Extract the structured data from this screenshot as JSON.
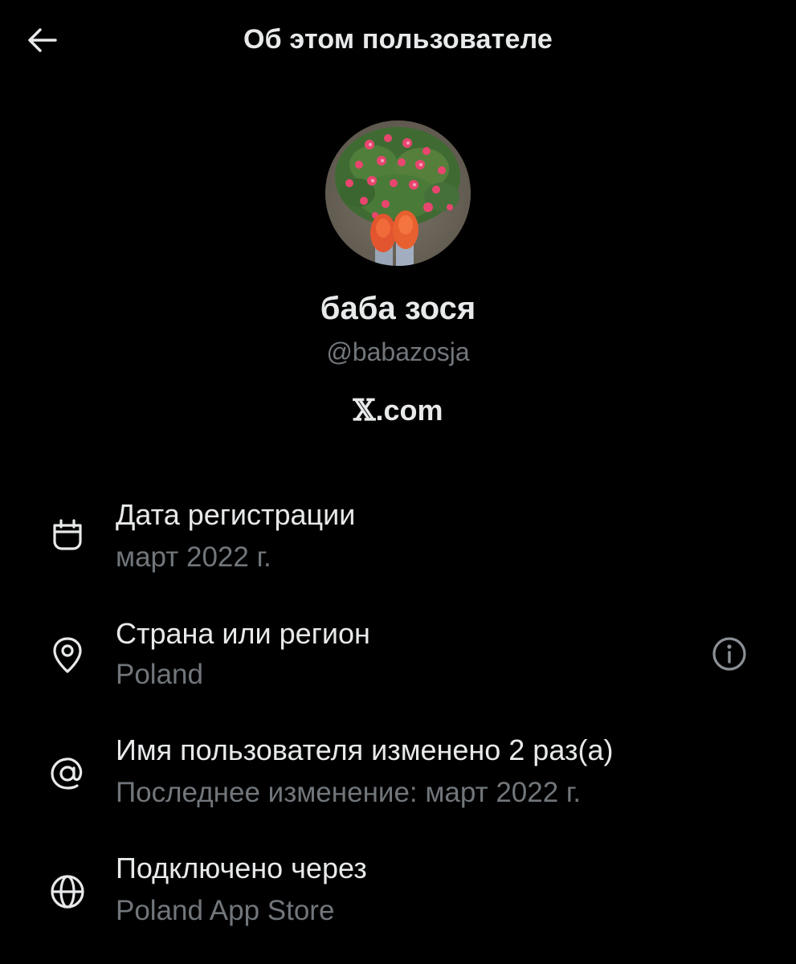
{
  "header": {
    "title": "Об этом пользователе",
    "back_icon": "arrow-left-icon"
  },
  "profile": {
    "display_name": "баба зося",
    "handle": "@babazosja",
    "platform_glyph": "𝕏",
    "platform_suffix": ".com",
    "avatar": "flowers-and-orange-shoes-photo"
  },
  "info": {
    "joined": {
      "icon": "calendar-icon",
      "title": "Дата регистрации",
      "value": "март 2022 г."
    },
    "country": {
      "icon": "location-pin-icon",
      "title": "Страна или регион",
      "value": "Poland",
      "help_icon": "info-circle-icon"
    },
    "username_changes": {
      "icon": "at-sign-icon",
      "title": "Имя пользователя изменено 2 раз(а)",
      "value": "Последнее изменение: март 2022 г."
    },
    "connected_via": {
      "icon": "globe-icon",
      "title": "Подключено через",
      "value": "Poland App Store"
    }
  },
  "colors": {
    "background": "#000000",
    "primary_text": "#e7e9ea",
    "secondary_text": "#71767b"
  }
}
